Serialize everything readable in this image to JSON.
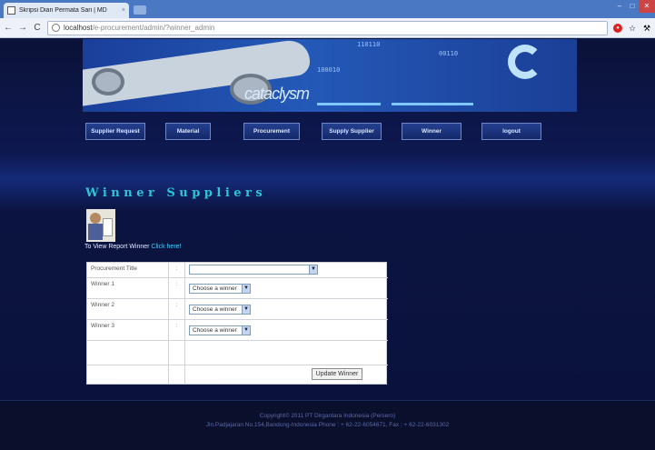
{
  "browser": {
    "tab_title": "Skripsi Dian Permata Sari | MD",
    "url_host": "localhost",
    "url_path": "/e-procurement/admin/?winner_admin",
    "back_label": "←",
    "forward_label": "→",
    "reload_label": "C",
    "close_tab_glyph": "×"
  },
  "banner": {
    "brand": "cataclysm",
    "numbers": [
      "110110",
      "00110",
      "100010"
    ]
  },
  "nav": {
    "items": [
      {
        "label": "Supplier Request"
      },
      {
        "label": "Material"
      },
      {
        "label": "Procurement"
      },
      {
        "label": "Supply Supplier"
      },
      {
        "label": "Winner"
      },
      {
        "label": "logout"
      }
    ]
  },
  "main": {
    "heading": "Winner Suppliers",
    "report_text": "To View Report Winner",
    "report_link": "Click here!"
  },
  "form": {
    "colon": ":",
    "rows": [
      {
        "label": "Procurement Title",
        "value": ""
      },
      {
        "label": "Winner 1",
        "value": "Choose a winner"
      },
      {
        "label": "Winner 2",
        "value": "Choose a winner"
      },
      {
        "label": "Winner 3",
        "value": "Choose a winner"
      }
    ],
    "submit_label": "Update Winner"
  },
  "footer": {
    "line1": "Copyright© 2011 PT Dirgantara Indonesia (Persero)",
    "line2": "Jln.Padjajaran No.154,Bandung-Indonesia Phone : + 62-22-6054671, Fax : + 62-22-6031302"
  },
  "colors": {
    "heading": "#2cc6d6",
    "link": "#3fd0ff",
    "page_bg": "#0c1440"
  }
}
